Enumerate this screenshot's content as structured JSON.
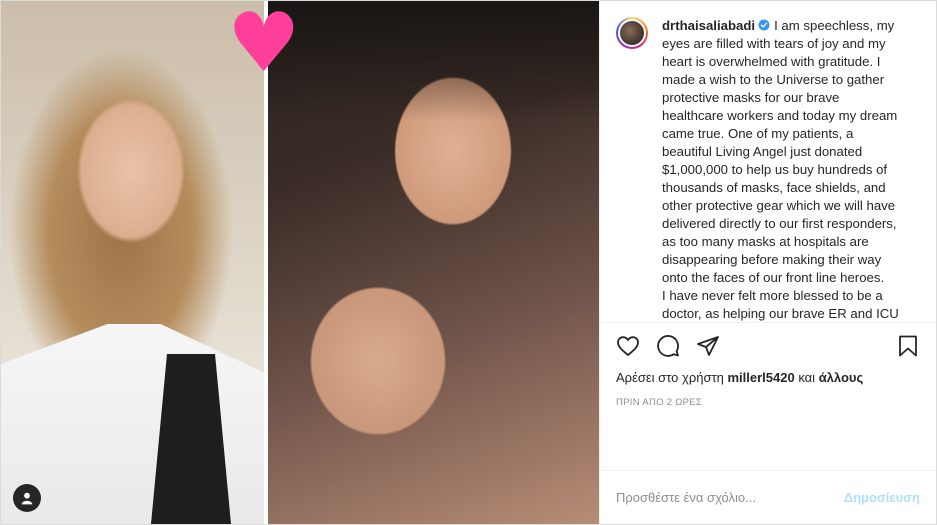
{
  "post": {
    "username": "drthaisaliabadi",
    "caption_paragraph_1": "I am speechless, my eyes are filled with tears of joy and my heart is overwhelmed with gratitude. I made a wish to the Universe to gather protective masks for our brave healthcare workers and today my dream came true. One of my patients, a beautiful Living Angel just donated $1,000,000 to help us buy hundreds of thousands of masks, face shields, and other protective gear which we will have delivered directly to our first responders, as too many masks at hospitals are disappearing before making their way onto the faces of our front line heroes.",
    "caption_paragraph_2": "I have never felt more blessed to be a doctor, as helping our brave ER and ICU workers feels just as gratifying as helping my own patients. From the",
    "likes_prefix": "Αρέσει στο χρήστη",
    "likes_user": "millerl5420",
    "likes_suffix": "και",
    "likes_others": "άλλους",
    "timestamp": "ΠΡΙΝ ΑΠΟ 2 ΩΡΕΣ",
    "comment_placeholder": "Προσθέστε ένα σχόλιο...",
    "post_button": "Δημοσίευση"
  },
  "icons": {
    "like": "heart-outline-icon",
    "comment": "speech-bubble-icon",
    "share": "paper-plane-icon",
    "save": "bookmark-icon",
    "user_tag": "user-icon",
    "verified": "verified-badge-icon",
    "image_heart": "pink-heart-emoji"
  },
  "colors": {
    "verified": "#3897f0",
    "post_button_disabled": "#b2dffc",
    "heart_emoji": "#ff3f9a",
    "muted_text": "#8e8e8e"
  }
}
